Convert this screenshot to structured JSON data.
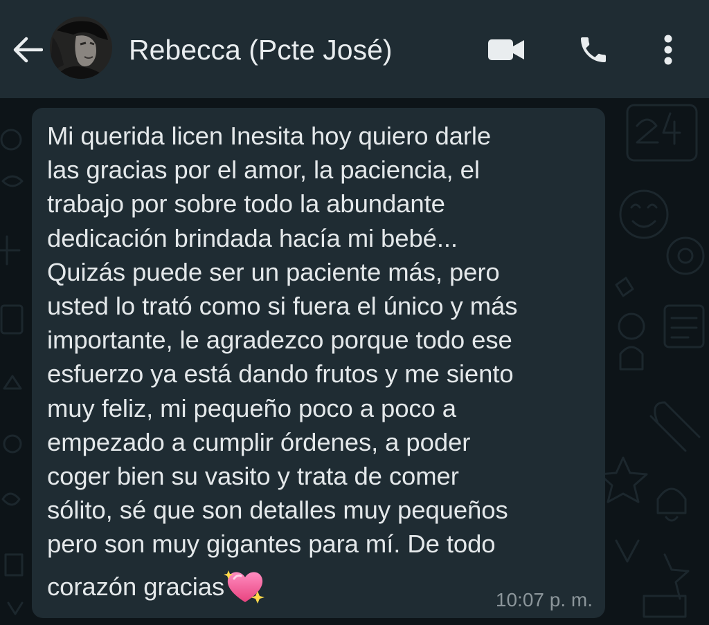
{
  "header": {
    "contact_name": "Rebecca (Pcte José)",
    "icons": {
      "back": "arrow-left-icon",
      "video": "videocam-icon",
      "call": "phone-icon",
      "menu": "more-vertical-icon"
    }
  },
  "message": {
    "lines": [
      "Mi querida licen Inesita hoy quiero darle",
      "las gracias por el amor, la paciencia, el",
      "trabajo por sobre todo la abundante",
      "dedicación brindada hacía mi bebé...",
      "Quizás puede ser un paciente más, pero",
      "usted lo trató como si fuera el único y más",
      "importante, le agradezco porque todo ese",
      "esfuerzo ya está dando frutos y me siento",
      "muy feliz, mi pequeño poco a poco a",
      "empezado a cumplir órdenes, a poder",
      "coger bien su vasito y trata de comer",
      "sólito, sé que son detalles muy pequeños",
      "pero son muy gigantes para mí. De todo"
    ],
    "last_line": "corazón gracias",
    "emoji": "sparkling-heart-icon",
    "time": "10:07 p. m."
  },
  "colors": {
    "header_bg": "#1f2c33",
    "chat_bg": "#0d1418",
    "bubble_bg": "#1f2c33",
    "text": "#e9edef",
    "meta_text": "#8c969b",
    "heart": "#ff5fa2"
  }
}
